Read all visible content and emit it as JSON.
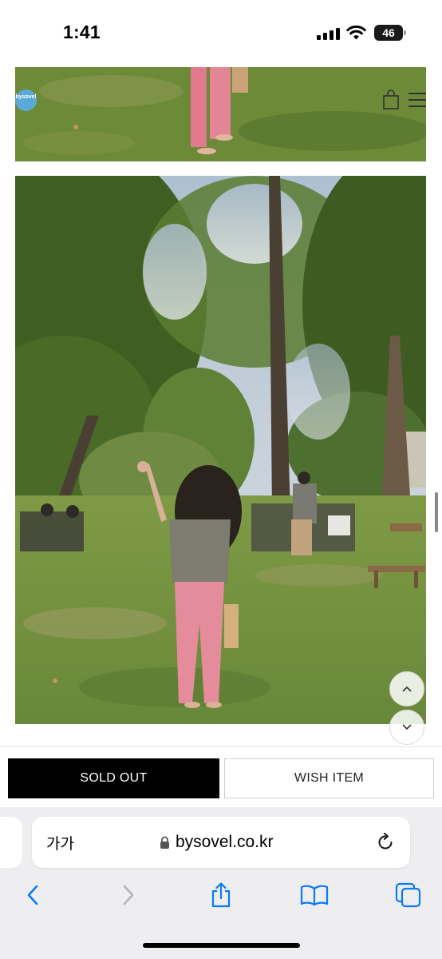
{
  "status_bar": {
    "time": "1:41",
    "battery": "46"
  },
  "site": {
    "logo_text": "bysovel"
  },
  "product": {
    "sold_out_label": "SOLD OUT",
    "wish_label": "WISH ITEM"
  },
  "browser": {
    "text_size_label": "가가",
    "url": "bysovel.co.kr"
  },
  "icons": [
    "signal-icon",
    "wifi-icon",
    "battery-icon",
    "cart-icon",
    "menu-icon",
    "chevron-up-icon",
    "chevron-down-icon",
    "lock-icon",
    "reload-icon",
    "back-icon",
    "forward-icon",
    "share-icon",
    "bookmarks-icon",
    "tabs-icon"
  ],
  "colors": {
    "accent": "#0a7aff",
    "sold_out_bg": "#000000",
    "logo": "#5aa9d8"
  }
}
